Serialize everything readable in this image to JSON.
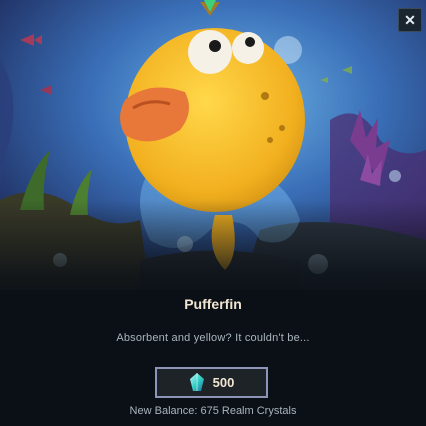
{
  "item": {
    "name": "Pufferfin",
    "description": "Absorbent and yellow? It couldn't be..."
  },
  "purchase": {
    "price": "500",
    "currency_icon": "realm-crystal-icon"
  },
  "balance": {
    "text": "New Balance: 675 Realm Crystals"
  },
  "close": {
    "label": "✕"
  },
  "colors": {
    "accent_border": "#8e95b8",
    "title_text": "#f0e6d2",
    "body_text": "#a9b4bd",
    "fish_yellow": "#f6c232"
  }
}
